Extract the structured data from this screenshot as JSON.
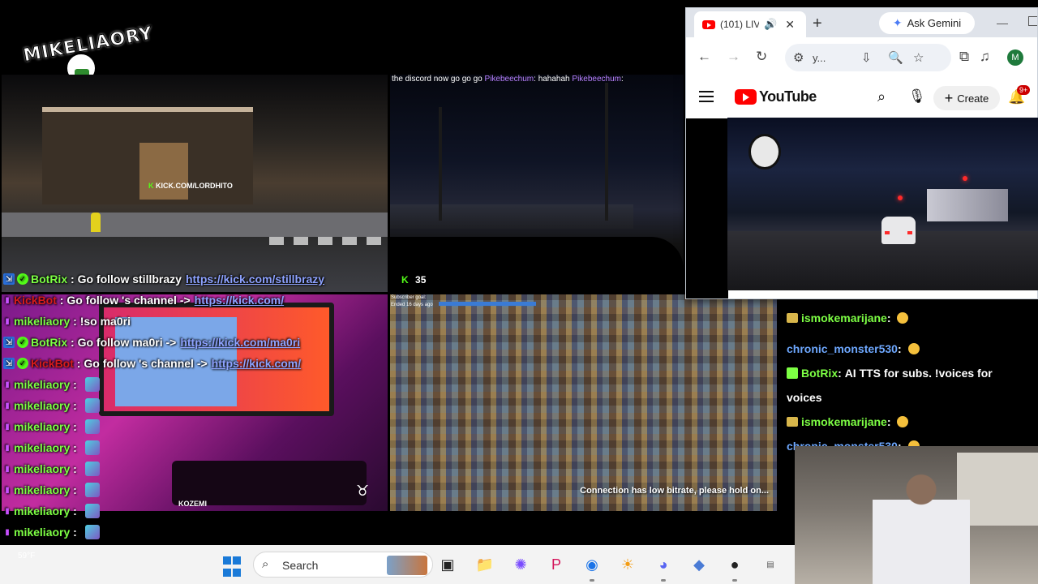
{
  "logo": {
    "text": "MIKELIAORY"
  },
  "tiles": {
    "top_left": {
      "overlay_user": "mikeliaory",
      "overlay_text": "KICK.COM/LORDHITO"
    },
    "top_right": {
      "discord_message": "the discord now go go go",
      "chat_user": "Pikebeechum",
      "chat_text": "hahahah",
      "chat_user_2": "Pikebeechum",
      "viewer_count": "35"
    },
    "bottom_left": {
      "tag": "KOZEMI"
    },
    "bottom_middle": {
      "subscriber_goal": "Subscriber goal:",
      "ended": "Ended 16 days ago",
      "status": "Connection has low bitrate, please hold on..."
    }
  },
  "left_chat": [
    {
      "user": "BotRix",
      "user_color": "green",
      "text": "Go follow stillbrazy",
      "link": "https://kick.com/stillbrazy",
      "badges": [
        "bot",
        "verified"
      ]
    },
    {
      "user": "KickBot",
      "user_color": "red",
      "text": "Go follow 's channel ->",
      "link": "https://kick.com/",
      "badges": [
        "mic"
      ]
    },
    {
      "user": "mikeliaory",
      "user_color": "green",
      "text": "!so ma0ri",
      "link": "",
      "badges": [
        "mic"
      ]
    },
    {
      "user": "BotRix",
      "user_color": "green",
      "text": "Go follow ma0ri ->",
      "link": "https://kick.com/ma0ri",
      "badges": [
        "bot",
        "verified"
      ]
    },
    {
      "user": "KickBot",
      "user_color": "red",
      "text": "Go follow 's channel ->",
      "link": "https://kick.com/",
      "badges": [
        "bot",
        "verified"
      ]
    },
    {
      "user": "mikeliaory",
      "user_color": "green",
      "text": "",
      "link": "",
      "badges": [
        "mic"
      ]
    },
    {
      "user": "mikeliaory",
      "user_color": "green",
      "text": "",
      "link": "",
      "badges": [
        "mic"
      ]
    },
    {
      "user": "mikeliaory",
      "user_color": "green",
      "text": "",
      "link": "",
      "badges": [
        "mic"
      ]
    },
    {
      "user": "mikeliaory",
      "user_color": "green",
      "text": "",
      "link": "",
      "badges": [
        "mic"
      ]
    },
    {
      "user": "mikeliaory",
      "user_color": "green",
      "text": "",
      "link": "",
      "badges": [
        "mic"
      ]
    },
    {
      "user": "mikeliaory",
      "user_color": "green",
      "text": "",
      "link": "",
      "badges": [
        "mic"
      ]
    },
    {
      "user": "mikeliaory",
      "user_color": "green",
      "text": "",
      "link": "",
      "badges": [
        "mic"
      ]
    },
    {
      "user": "mikeliaory",
      "user_color": "green",
      "text": "",
      "link": "",
      "badges": [
        "mic"
      ]
    },
    {
      "user": "mikeliaory",
      "user_color": "green",
      "text": "",
      "link": "",
      "badges": [
        "mic"
      ]
    },
    {
      "user": "mikeliaory",
      "user_color": "green",
      "text": "",
      "link": "",
      "badges": [
        "mic"
      ]
    }
  ],
  "browser": {
    "tab_title": "(101) LIVE",
    "new_tab": "+",
    "gemini_label": "Ask Gemini",
    "omnibox_text": "y...",
    "profile_initial": "M",
    "youtube": {
      "logo_text": "YouTube",
      "create_label": "Create",
      "notifications": "9+"
    }
  },
  "right_chat": [
    {
      "user": "ismokemarijane",
      "user_color": "green",
      "text": ""
    },
    {
      "user": "chronic_monster530",
      "user_color": "blue",
      "text": ""
    },
    {
      "user": "BotRix",
      "user_color": "green",
      "text": "AI TTS for subs. !voices for"
    },
    {
      "user": "",
      "user_color": "",
      "text": "voices"
    },
    {
      "user": "ismokemarijane",
      "user_color": "green",
      "text": ""
    },
    {
      "user": "chronic_monster530",
      "user_color": "blue",
      "text": ""
    }
  ],
  "taskbar": {
    "search_label": "Search",
    "weather_temp": "59°F"
  },
  "colors": {
    "kick_green": "#53fc18",
    "chat_green": "#7dff44",
    "chat_red": "#d81b1b",
    "link_blue": "#8da2ff",
    "youtube_red": "#ff0000"
  }
}
